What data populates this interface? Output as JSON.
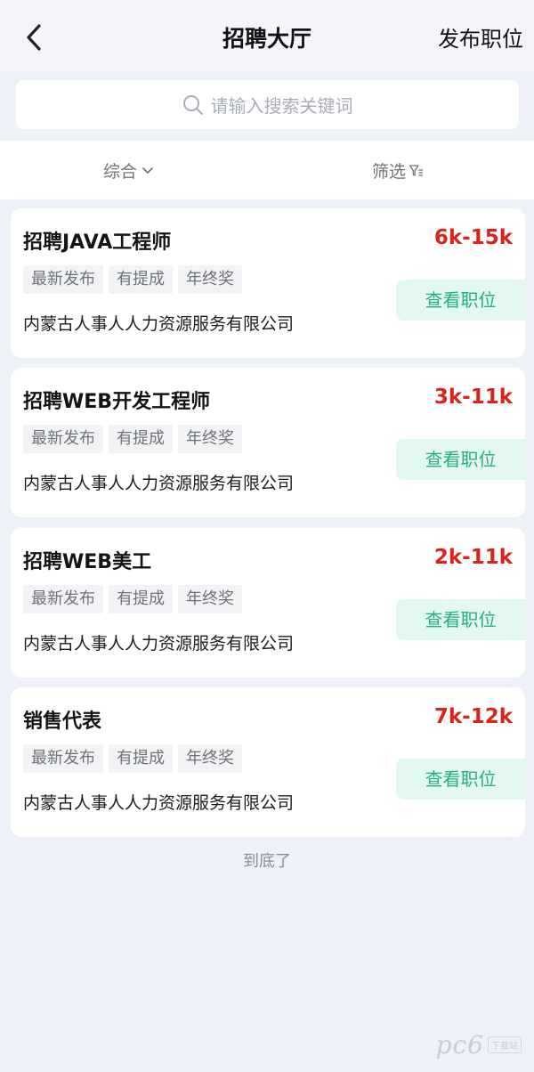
{
  "header": {
    "back_icon": "chevron-left-icon",
    "title": "招聘大厅",
    "publish_label": "发布职位"
  },
  "search": {
    "icon": "search-icon",
    "placeholder": "请输入搜索关键词"
  },
  "filters": {
    "sort_label": "综合",
    "sort_icon": "chevron-down-icon",
    "filter_label": "筛选",
    "filter_icon": "funnel-icon"
  },
  "jobs": [
    {
      "title": "招聘JAVA工程师",
      "salary": "6k-15k",
      "tags": [
        "最新发布",
        "有提成",
        "年终奖"
      ],
      "company": "内蒙古人事人人力资源服务有限公司",
      "action": "查看职位"
    },
    {
      "title": "招聘WEB开发工程师",
      "salary": "3k-11k",
      "tags": [
        "最新发布",
        "有提成",
        "年终奖"
      ],
      "company": "内蒙古人事人人力资源服务有限公司",
      "action": "查看职位"
    },
    {
      "title": "招聘WEB美工",
      "salary": "2k-11k",
      "tags": [
        "最新发布",
        "有提成",
        "年终奖"
      ],
      "company": "内蒙古人事人人力资源服务有限公司",
      "action": "查看职位"
    },
    {
      "title": "销售代表",
      "salary": "7k-12k",
      "tags": [
        "最新发布",
        "有提成",
        "年终奖"
      ],
      "company": "内蒙古人事人人力资源服务有限公司",
      "action": "查看职位"
    }
  ],
  "end_text": "到底了",
  "watermark": {
    "logo": "pc6",
    "badge": "下载站"
  },
  "colors": {
    "background": "#eef1f8",
    "salary": "#d9231b",
    "action_bg": "#e2f8f0",
    "action_text": "#26b07c"
  }
}
